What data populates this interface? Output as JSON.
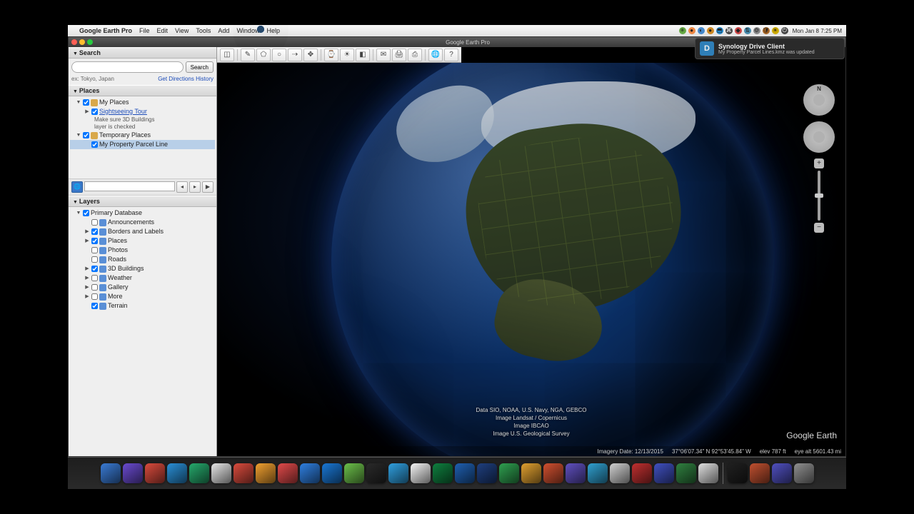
{
  "menubar": {
    "app_name": "Google Earth Pro",
    "menus": [
      "File",
      "Edit",
      "View",
      "Tools",
      "Add",
      "Window",
      "Help"
    ],
    "clock": "Mon Jan 8  7:25 PM"
  },
  "window": {
    "title": "Google Earth Pro"
  },
  "notification": {
    "icon_letter": "D",
    "title": "Synology Drive Client",
    "body": "My Property Parcel Lines.kmz was updated"
  },
  "search": {
    "header": "Search",
    "placeholder": "",
    "button": "Search",
    "hint": "ex: Tokyo, Japan",
    "links": {
      "directions": "Get Directions",
      "history": "History"
    }
  },
  "places": {
    "header": "Places",
    "items": [
      {
        "level": 1,
        "label": "My Places",
        "icon": "folder",
        "checked": true,
        "disc": "▼"
      },
      {
        "level": 2,
        "label": "Sightseeing Tour",
        "icon": "globe",
        "checked": true,
        "link": true,
        "disc": "▶"
      },
      {
        "level": 3,
        "note": "Make sure 3D Buildings"
      },
      {
        "level": 3,
        "note": "layer is checked"
      },
      {
        "level": 1,
        "label": "Temporary Places",
        "icon": "folder",
        "checked": true,
        "disc": "▼"
      },
      {
        "level": 2,
        "label": "My Property Parcel Line",
        "icon": "globe",
        "checked": true,
        "selected": true,
        "disc": ""
      }
    ]
  },
  "layers": {
    "header": "Layers",
    "items": [
      {
        "level": 1,
        "label": "Primary Database",
        "icon": "globe",
        "checked": true,
        "disc": "▼"
      },
      {
        "level": 2,
        "label": "Announcements",
        "icon": "ico",
        "checked": false,
        "disc": ""
      },
      {
        "level": 2,
        "label": "Borders and Labels",
        "icon": "ico",
        "checked": true,
        "disc": "▶"
      },
      {
        "level": 2,
        "label": "Places",
        "icon": "ico",
        "checked": true,
        "disc": "▶"
      },
      {
        "level": 2,
        "label": "Photos",
        "icon": "ico",
        "checked": false,
        "disc": ""
      },
      {
        "level": 2,
        "label": "Roads",
        "icon": "ico",
        "checked": false,
        "disc": ""
      },
      {
        "level": 2,
        "label": "3D Buildings",
        "icon": "ico",
        "checked": true,
        "disc": "▶"
      },
      {
        "level": 2,
        "label": "Weather",
        "icon": "ico",
        "checked": false,
        "disc": "▶"
      },
      {
        "level": 2,
        "label": "Gallery",
        "icon": "ico",
        "checked": false,
        "disc": "▶"
      },
      {
        "level": 2,
        "label": "More",
        "icon": "ico",
        "checked": false,
        "disc": "▶"
      },
      {
        "level": 2,
        "label": "Terrain",
        "icon": "ico",
        "checked": true,
        "disc": ""
      }
    ]
  },
  "toolbar_icons": [
    "◫",
    "✎",
    "⬠",
    "○",
    "⇢",
    "✥",
    "⌚",
    "☀",
    "◧",
    "✉",
    "🖨",
    "⎙",
    "🌐",
    "?"
  ],
  "attribution": [
    "Data SIO, NOAA, U.S. Navy, NGA, GEBCO",
    "Image Landsat / Copernicus",
    "Image IBCAO",
    "Image U.S. Geological Survey"
  ],
  "status": {
    "imagery": "Imagery Date: 12/13/2015",
    "coords": "37°06'07.34\" N   92°53'45.84\" W",
    "elev": "elev  787 ft",
    "eye": "eye alt 5601.43 mi"
  },
  "logo": "Google Earth",
  "dock_colors": [
    "#3a7bd5",
    "#6a4bd0",
    "#d94b3d",
    "#2a8fd6",
    "#26a96c",
    "#e6e6e6",
    "#d94b3d",
    "#f0a030",
    "#e04a4a",
    "#2f7fe0",
    "#1a77d4",
    "#6cc04a",
    "#2a2a2a",
    "#30a0e0",
    "#f5f5f5",
    "#0f7f3f",
    "#1f5fb0",
    "#1f3f7f",
    "#2fa050",
    "#e0a030",
    "#d05030",
    "#6050c0",
    "#30a0d0",
    "#d0d0d0",
    "#c03030",
    "#4050c0",
    "#308040",
    "#e0e0e0",
    "#202020",
    "#c05030",
    "#5050c0",
    "#909090"
  ]
}
